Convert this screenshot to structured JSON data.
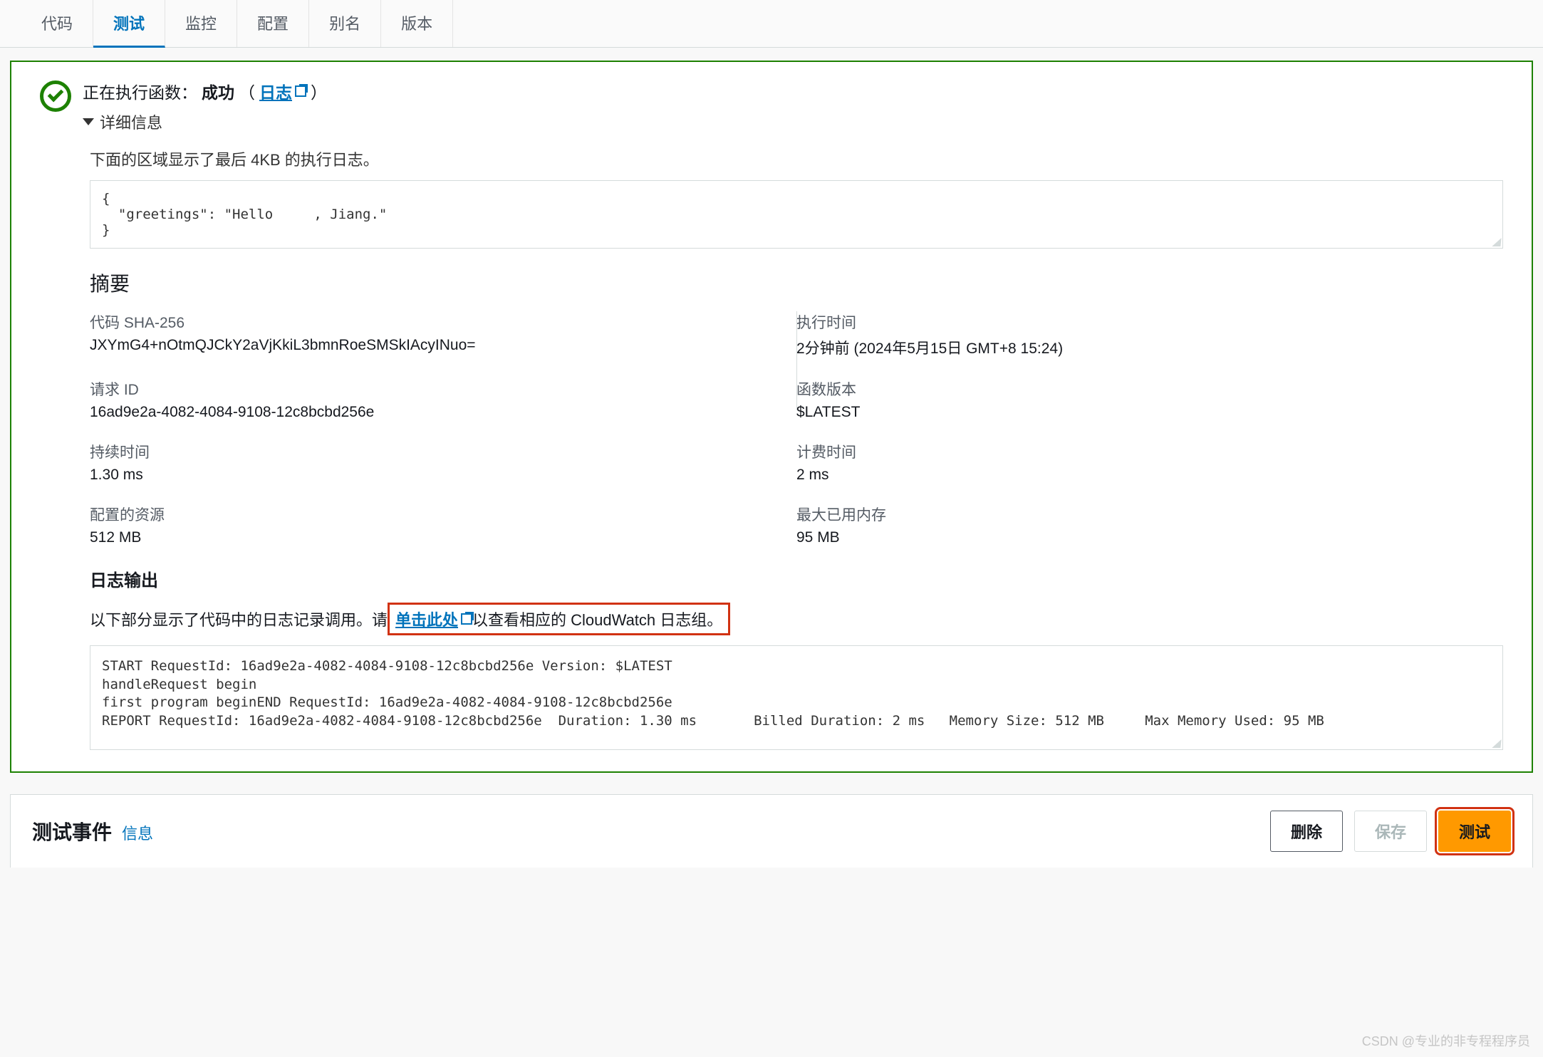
{
  "tabs": [
    "代码",
    "测试",
    "监控",
    "配置",
    "别名",
    "版本"
  ],
  "activeTab": 1,
  "alert": {
    "prefix": "正在执行函数：",
    "status": "成功",
    "logsLinkLabel": "日志",
    "detailsLabel": "详细信息"
  },
  "logPreview": {
    "description": "下面的区域显示了最后 4KB 的执行日志。",
    "body": "{\n  \"greetings\": \"Hello     , Jiang.\"\n}"
  },
  "summary": {
    "title": "摘要",
    "items": [
      {
        "k": "代码 SHA-256",
        "v": "JXYmG4+nOtmQJCkY2aVjKkiL3bmnRoeSMSkIAcyINuo="
      },
      {
        "k": "执行时间",
        "v": "2分钟前 (2024年5月15日 GMT+8 15:24)"
      },
      {
        "k": "请求 ID",
        "v": "16ad9e2a-4082-4084-9108-12c8bcbd256e"
      },
      {
        "k": "函数版本",
        "v": "$LATEST"
      },
      {
        "k": "持续时间",
        "v": "1.30 ms"
      },
      {
        "k": "计费时间",
        "v": "2 ms"
      },
      {
        "k": "配置的资源",
        "v": "512 MB"
      },
      {
        "k": "最大已用内存",
        "v": "95 MB"
      }
    ]
  },
  "logOutput": {
    "title": "日志输出",
    "prefix": "以下部分显示了代码中的日志记录调用。请",
    "linkLabel": "单击此处",
    "suffix": "以查看相应的 CloudWatch 日志组。",
    "body": "START RequestId: 16ad9e2a-4082-4084-9108-12c8bcbd256e Version: $LATEST\nhandleRequest begin\nfirst program beginEND RequestId: 16ad9e2a-4082-4084-9108-12c8bcbd256e\nREPORT RequestId: 16ad9e2a-4082-4084-9108-12c8bcbd256e  Duration: 1.30 ms       Billed Duration: 2 ms   Memory Size: 512 MB     Max Memory Used: 95 MB"
  },
  "footer": {
    "title": "测试事件",
    "infoLink": "信息",
    "deleteLabel": "删除",
    "saveLabel": "保存",
    "testLabel": "测试"
  },
  "watermark": "CSDN @专业的非专程程序员"
}
